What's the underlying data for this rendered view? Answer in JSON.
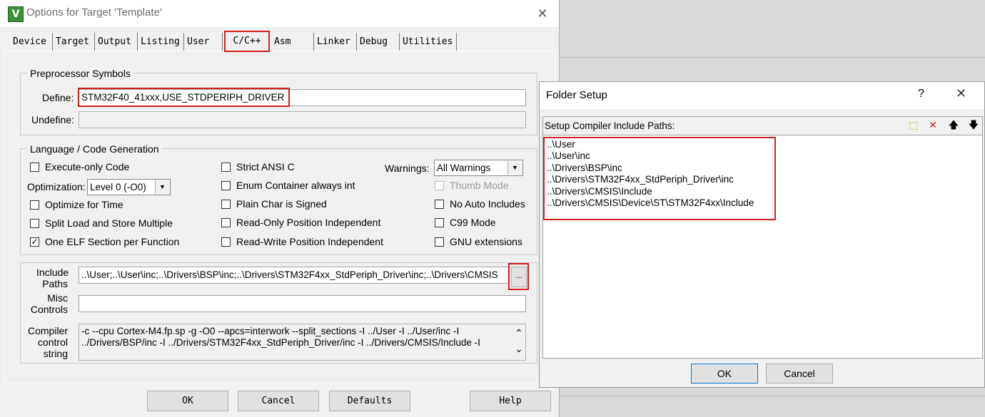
{
  "options_window": {
    "title": "Options for Target 'Template'",
    "logo_letter": "V",
    "close_glyph": "✕",
    "tabs": [
      "Device",
      "Target",
      "Output",
      "Listing",
      "User",
      "C/C++",
      "Asm",
      "Linker",
      "Debug",
      "Utilities"
    ],
    "active_tab": "C/C++",
    "preprocessor": {
      "legend": "Preprocessor Symbols",
      "define_label": "Define:",
      "define_value": "STM32F40_41xxx,USE_STDPERIPH_DRIVER",
      "undefine_label": "Undefine:",
      "undefine_value": ""
    },
    "language": {
      "legend": "Language / Code Generation",
      "execute_only": "Execute-only Code",
      "optimization_label": "Optimization:",
      "optimization_value": "Level 0 (-O0)",
      "optimize_for_time": "Optimize for Time",
      "split_load": "Split Load and Store Multiple",
      "one_elf": "One ELF Section per Function",
      "strict_ansi": "Strict ANSI C",
      "enum_container": "Enum Container always int",
      "plain_char": "Plain Char is Signed",
      "ropi": "Read-Only Position Independent",
      "rwpi": "Read-Write Position Independent",
      "warnings_label": "Warnings:",
      "warnings_value": "All Warnings",
      "thumb_mode": "Thumb Mode",
      "no_auto_includes": "No Auto Includes",
      "c99_mode": "C99 Mode",
      "gnu_ext": "GNU extensions",
      "checkmark": "✓"
    },
    "include_paths": {
      "label_line1": "Include",
      "label_line2": "Paths",
      "value": "..\\User;..\\User\\inc;..\\Drivers\\BSP\\inc;..\\Drivers\\STM32F4xx_StdPeriph_Driver\\inc;..\\Drivers\\CMSIS",
      "browse_label": "..."
    },
    "misc_controls": {
      "label_line1": "Misc",
      "label_line2": "Controls",
      "value": ""
    },
    "compiler_control": {
      "label_line1": "Compiler",
      "label_line2": "control",
      "label_line3": "string",
      "line1": "-c --cpu Cortex-M4.fp.sp -g -O0 --apcs=interwork --split_sections -I ../User -I ../User/inc -I",
      "line2": "../Drivers/BSP/inc -I ../Drivers/STM32F4xx_StdPeriph_Driver/inc -I ../Drivers/CMSIS/Include -I",
      "scroll_up": "⌃",
      "scroll_down": "⌄"
    },
    "buttons": {
      "ok": "OK",
      "cancel": "Cancel",
      "defaults": "Defaults",
      "help": "Help"
    }
  },
  "folder_setup": {
    "title": "Folder Setup",
    "help_glyph": "?",
    "close_glyph": "✕",
    "header": "Setup Compiler Include Paths:",
    "tools": {
      "new": "⬚",
      "delete": "✕",
      "up": "🡅",
      "down": "🡇"
    },
    "paths": [
      "..\\User",
      "..\\User\\inc",
      "..\\Drivers\\BSP\\inc",
      "..\\Drivers\\STM32F4xx_StdPeriph_Driver\\inc",
      "..\\Drivers\\CMSIS\\Include",
      "..\\Drivers\\CMSIS\\Device\\ST\\STM32F4xx\\Include"
    ],
    "ok_label": "OK",
    "cancel_label": "Cancel"
  },
  "colors": {
    "highlight_red": "#d02020",
    "window_bg": "#f0f0f0",
    "logo_green": "#3c8f3c"
  }
}
